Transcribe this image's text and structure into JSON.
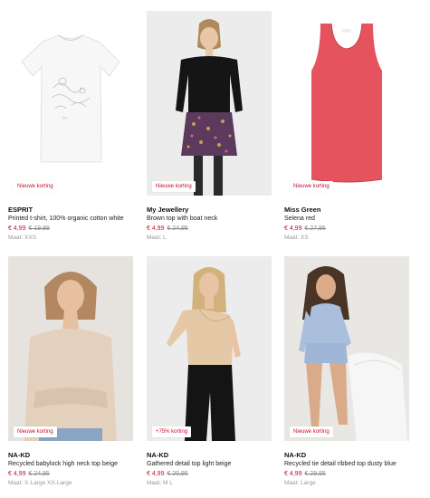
{
  "products": [
    {
      "brand": "ESPRIT",
      "title": "Printed t-shirt, 100% organic cotton white",
      "price_new": "€ 4,99",
      "price_old": "€ 19,99",
      "size": "Maat: XXS",
      "badge": "Nieuwe korting",
      "image": "white-printed-tshirt"
    },
    {
      "brand": "My Jewellery",
      "title": "Brown top with boat neck",
      "price_new": "€ 4,99",
      "price_old": "€ 24,95",
      "size": "Maat: L",
      "badge": "Nieuwe korting",
      "image": "model-black-top-floral-skirt"
    },
    {
      "brand": "Miss Green",
      "title": "Selena red",
      "price_new": "€ 4,99",
      "price_old": "€ 27,95",
      "size": "Maat: XS",
      "badge": "Nieuwe korting",
      "image": "red-tank-top"
    },
    {
      "brand": "NA-KD",
      "title": "Recycled babylock high neck top beige",
      "price_new": "€ 4,99",
      "price_old": "€ 24,95",
      "size": "Maat: X-Large XX-Large",
      "badge": "Nieuwe korting",
      "image": "model-beige-knit-top"
    },
    {
      "brand": "NA-KD",
      "title": "Gathered detail top light beige",
      "price_new": "€ 4,99",
      "price_old": "€ 20,95",
      "size": "Maat: M L",
      "badge": "+75% korting",
      "image": "model-satin-one-shoulder-top"
    },
    {
      "brand": "NA-KD",
      "title": "Recycled tie detail ribbed top dusty blue",
      "price_new": "€ 4,99",
      "price_old": "€ 29,95",
      "size": "Maat: Large",
      "badge": "Nieuwe korting",
      "image": "model-blue-ribbed-top"
    }
  ],
  "colors": {
    "sale_red": "#c8102e",
    "muted_grey": "#8a8a8a"
  }
}
